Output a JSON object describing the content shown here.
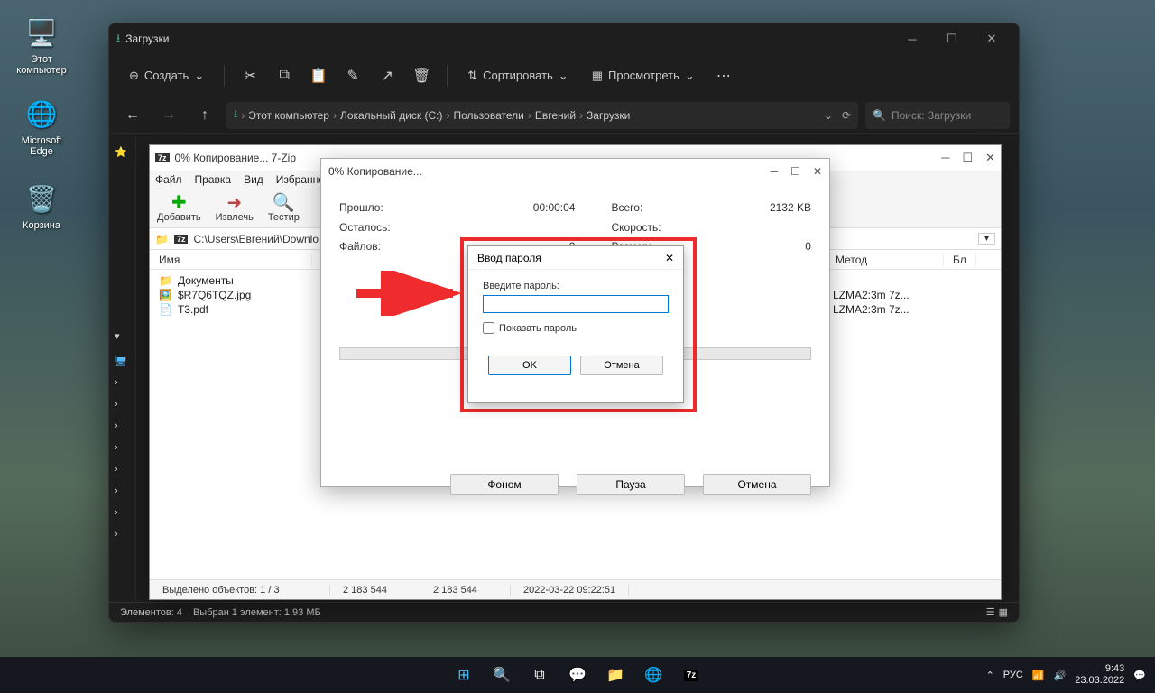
{
  "desktop_icons": {
    "this_pc": "Этот компьютер",
    "edge": "Microsoft Edge",
    "recycle": "Корзина"
  },
  "explorer": {
    "title": "Загрузки",
    "toolbar": {
      "create": "Создать",
      "sort": "Сортировать",
      "view": "Просмотреть"
    },
    "breadcrumb": [
      "Этот компьютер",
      "Локальный диск (C:)",
      "Пользователи",
      "Евгений",
      "Загрузки"
    ],
    "search_placeholder": "Поиск: Загрузки",
    "statusbar": {
      "elements": "Элементов: 4",
      "selected": "Выбран 1 элемент: 1,93 МБ"
    }
  },
  "sevenzip_fm": {
    "title": "0% Копирование... 7-Zip",
    "menu": [
      "Файл",
      "Правка",
      "Вид",
      "Избранное"
    ],
    "tb": {
      "add": "Добавить",
      "extract": "Извлечь",
      "test": "Тестир"
    },
    "path": "C:\\Users\\Евгений\\Downlo",
    "cols": {
      "name": "Имя",
      "method": "Метод",
      "bl": "Бл"
    },
    "rows": [
      {
        "name": "Документы",
        "method": "",
        "type": "folder"
      },
      {
        "name": "$R7Q6TQZ.jpg",
        "method": "LZMA2:3m 7z...",
        "type": "jpg"
      },
      {
        "name": "T3.pdf",
        "method": "LZMA2:3m 7z...",
        "type": "pdf"
      }
    ],
    "status": {
      "sel": "Выделено объектов: 1 / 3",
      "size1": "2 183 544",
      "size2": "2 183 544",
      "date": "2022-03-22 09:22:51"
    }
  },
  "progress": {
    "title": "0% Копирование...",
    "elapsed_label": "Прошло:",
    "elapsed_value": "00:00:04",
    "remaining_label": "Осталось:",
    "files_label": "Файлов:",
    "files_value": "0",
    "total_label": "Всего:",
    "total_value": "2132 KB",
    "speed_label": "Скорость:",
    "size_label": "Размер:",
    "size_value": "0",
    "buttons": {
      "background": "Фоном",
      "pause": "Пауза",
      "cancel": "Отмена"
    }
  },
  "password_dialog": {
    "title": "Ввод пароля",
    "label": "Введите пароль:",
    "show_password": "Показать пароль",
    "ok": "OK",
    "cancel": "Отмена"
  },
  "taskbar": {
    "lang": "РУС",
    "time": "9:43",
    "date": "23.03.2022"
  }
}
